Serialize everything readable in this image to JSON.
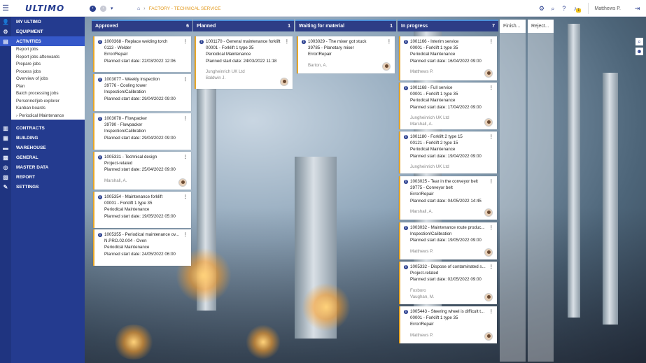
{
  "app": {
    "logo": "ULTIMO",
    "user": "Matthews P.",
    "notif_count": "1"
  },
  "breadcrumb": {
    "path": "FACTORY - TECHNICAL SERVICE"
  },
  "sidebar": {
    "items": [
      {
        "label": "MY ULTIMO",
        "icon": "person-icon"
      },
      {
        "label": "EQUIPMENT",
        "icon": "gear-icon"
      },
      {
        "label": "ACTIVITIES",
        "icon": "clipboard-icon"
      },
      {
        "label": "CONTRACTS",
        "icon": "document-icon"
      },
      {
        "label": "BUILDING",
        "icon": "building-icon"
      },
      {
        "label": "WAREHOUSE",
        "icon": "warehouse-icon"
      },
      {
        "label": "GENERAL",
        "icon": "grid-icon"
      },
      {
        "label": "MASTER DATA",
        "icon": "database-icon"
      },
      {
        "label": "REPORT",
        "icon": "report-icon"
      },
      {
        "label": "SETTINGS",
        "icon": "wrench-icon"
      }
    ],
    "submenu": [
      "Report jobs",
      "Report jobs afterwards",
      "Prepare jobs",
      "Process jobs",
      "Overview of jobs",
      "Plan",
      "Batch processing jobs",
      "Personnel/job explorer",
      "Kanban boards",
      "Periodical Maintenance"
    ]
  },
  "columns": [
    {
      "title": "Approved",
      "count": "6",
      "cards": [
        {
          "t1": "1000368 - Replace welding torch",
          "l2": "0113 - Welder",
          "l3": "Error/Repair",
          "l4": "Planned start date: 22/03/2022 12:06",
          "g1": "",
          "g2": ""
        },
        {
          "t1": "1003077 - Weekly inspection",
          "l2": "39776 - Cooling tower",
          "l3": "Inspection/Calibration",
          "l4": "Planned start date: 29/04/2022 09:00",
          "g1": "",
          "g2": ""
        },
        {
          "t1": "1003078 - Flowpacker",
          "l2": "39790 - Flowpacker",
          "l3": "Inspection/Calibration",
          "l4": "Planned start date: 29/04/2022 09:00",
          "g1": "",
          "g2": ""
        },
        {
          "t1": "1005331 - Technical design",
          "l2": "Project-related",
          "l3": "Planned start date: 25/04/2022 09:00",
          "l4": "",
          "g1": "",
          "g2": "Marshall, A."
        },
        {
          "t1": "1005354 - Maintenance forklift",
          "l2": "00001 - Forklift 1 type 35",
          "l3": "Periodical Maintenance",
          "l4": "Planned start date: 19/05/2022 05:00",
          "g1": "",
          "g2": ""
        },
        {
          "t1": "1005355 - Periodical maintenance ov...",
          "l2": "N.PRO.02.004 - Oven",
          "l3": "Periodical Maintenance",
          "l4": "Planned start date: 24/05/2022 06:00",
          "g1": "",
          "g2": ""
        }
      ]
    },
    {
      "title": "Planned",
      "count": "1",
      "cards": [
        {
          "t1": "1001170 - General maintenance forklift",
          "l2": "00001 - Forklift 1 type 35",
          "l3": "Periodical Maintenance",
          "l4": "Planned start date: 24/03/2022 11:18",
          "g1": "Jungheinrich UK Ltd",
          "g2": "Baldwin J."
        }
      ]
    },
    {
      "title": "Waiting for material",
      "count": "1",
      "cards": [
        {
          "t1": "1003029 - The mixer got stuck",
          "l2": "39785 - Planetary mixer",
          "l3": "Error/Repair",
          "l4": "",
          "g1": "",
          "g2": "Barton, A."
        }
      ]
    },
    {
      "title": "In progress",
      "count": "7",
      "cards": [
        {
          "t1": "1001166 - Interim service",
          "l2": "00001 - Forklift 1 type 35",
          "l3": "Periodical Maintenance",
          "l4": "Planned start date: 16/04/2022 09:00",
          "g1": "",
          "g2": "Matthews P."
        },
        {
          "t1": "1001168 - Full service",
          "l2": "00001 - Forklift 1 type 35",
          "l3": "Periodical Maintenance",
          "l4": "Planned start date: 17/04/2022 09:00",
          "g1": "Jungheinrich UK Ltd",
          "g2": "Marshall, A."
        },
        {
          "t1": "1001180 - Forklift 2 type 15",
          "l2": "00121 - Forklift 2 type 15",
          "l3": "Periodical Maintenance",
          "l4": "Planned start date: 19/04/2022 09:00",
          "g1": "Jungheinrich UK Ltd",
          "g2": ""
        },
        {
          "t1": "1003025 - Tear in the conveyor belt",
          "l2": "39775 - Conveyor belt",
          "l3": "Error/Repair",
          "l4": "Planned start date: 04/05/2022 14:45",
          "g1": "",
          "g2": "Marshall, A."
        },
        {
          "t1": "1003032 - Maintenance route produc...",
          "l2": "Inspection/Calibration",
          "l3": "Planned start date: 19/05/2022 09:00",
          "l4": "",
          "g1": "",
          "g2": "Matthews P."
        },
        {
          "t1": "1005332 - Dispose of contaminated s...",
          "l2": "Project-related",
          "l3": "Planned start date: 02/05/2022 09:00",
          "l4": "",
          "g1": "Foxboro",
          "g2": "Vaughan, M."
        },
        {
          "t1": "1005443 - Steering wheel is difficult t...",
          "l2": "00001 - Forklift 1 type 35",
          "l3": "Error/Repair",
          "l4": "",
          "g1": "",
          "g2": "Matthews P."
        }
      ]
    },
    {
      "title": "Finish...",
      "count": "",
      "cards": []
    },
    {
      "title": "Reject...",
      "count": "",
      "cards": []
    }
  ]
}
